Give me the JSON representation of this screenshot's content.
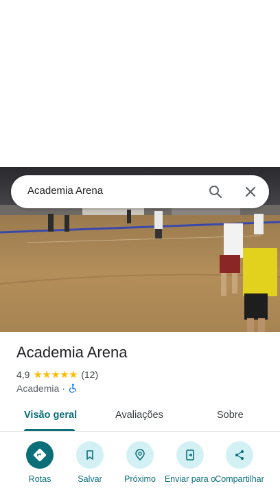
{
  "search": {
    "query": "Academia Arena"
  },
  "place": {
    "title": "Academia Arena",
    "rating": "4,9",
    "stars": "★★★★★",
    "review_count": "(12)",
    "category": "Academia",
    "separator": "·"
  },
  "tabs": [
    {
      "label": "Visão geral",
      "active": true
    },
    {
      "label": "Avaliações",
      "active": false
    },
    {
      "label": "Sobre",
      "active": false
    }
  ],
  "actions": [
    {
      "label": "Rotas",
      "icon": "directions-icon"
    },
    {
      "label": "Salvar",
      "icon": "bookmark-icon"
    },
    {
      "label": "Próximo",
      "icon": "nearby-icon"
    },
    {
      "label": "Enviar para o",
      "icon": "send-to-phone-icon"
    },
    {
      "label": "Compartilhar",
      "icon": "share-icon"
    }
  ],
  "colors": {
    "accent": "#0b6e79",
    "accent_light": "#d3f1f5",
    "star": "#fbbc04"
  }
}
